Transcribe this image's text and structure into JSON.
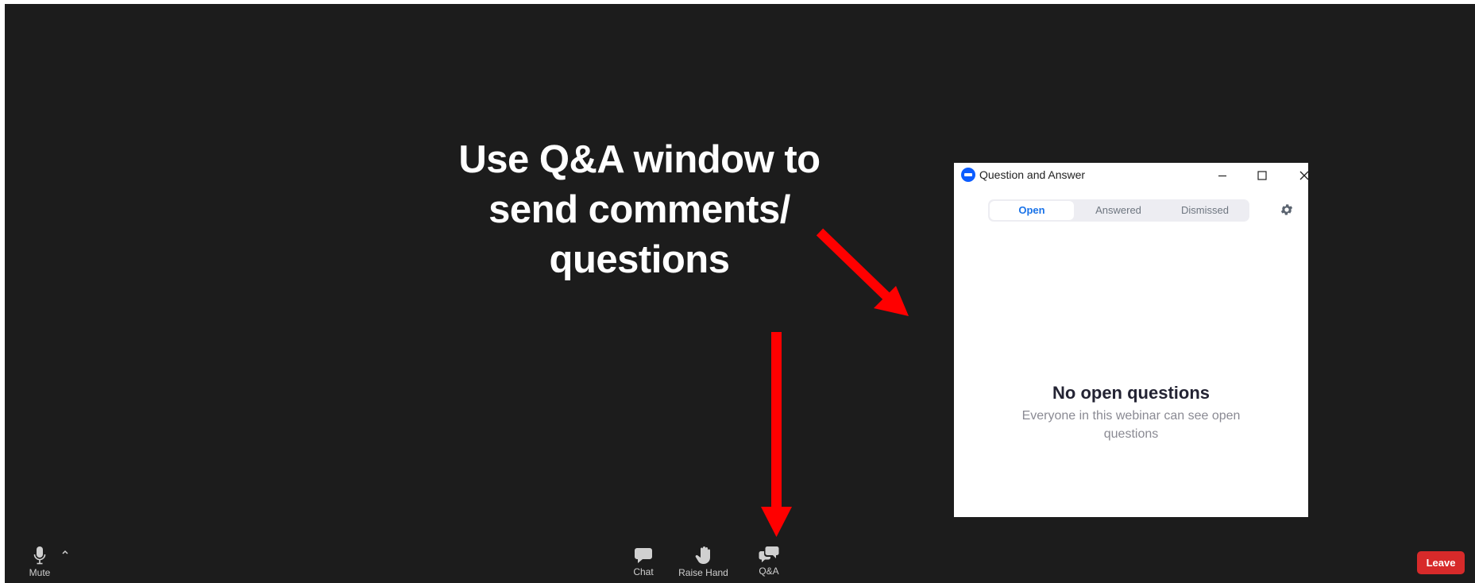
{
  "overlay": {
    "instruction_lines": [
      "Use Q&A window to",
      "send comments/",
      "questions"
    ],
    "arrow_color": "#ff0000"
  },
  "qa_window": {
    "title": "Question and Answer",
    "tabs": [
      {
        "label": "Open",
        "selected": true
      },
      {
        "label": "Answered",
        "selected": false
      },
      {
        "label": "Dismissed",
        "selected": false
      }
    ],
    "empty_state": {
      "title": "No open questions",
      "subtitle": "Everyone in this webinar can see open questions"
    },
    "icons": [
      "zoom-logo-icon",
      "minimize-icon",
      "maximize-icon",
      "close-icon",
      "gear-icon"
    ]
  },
  "toolbar": {
    "mute_label": "Mute",
    "chat_label": "Chat",
    "raise_hand_label": "Raise Hand",
    "qa_label": "Q&A",
    "leave_label": "Leave",
    "leave_color": "#d72a2a"
  }
}
